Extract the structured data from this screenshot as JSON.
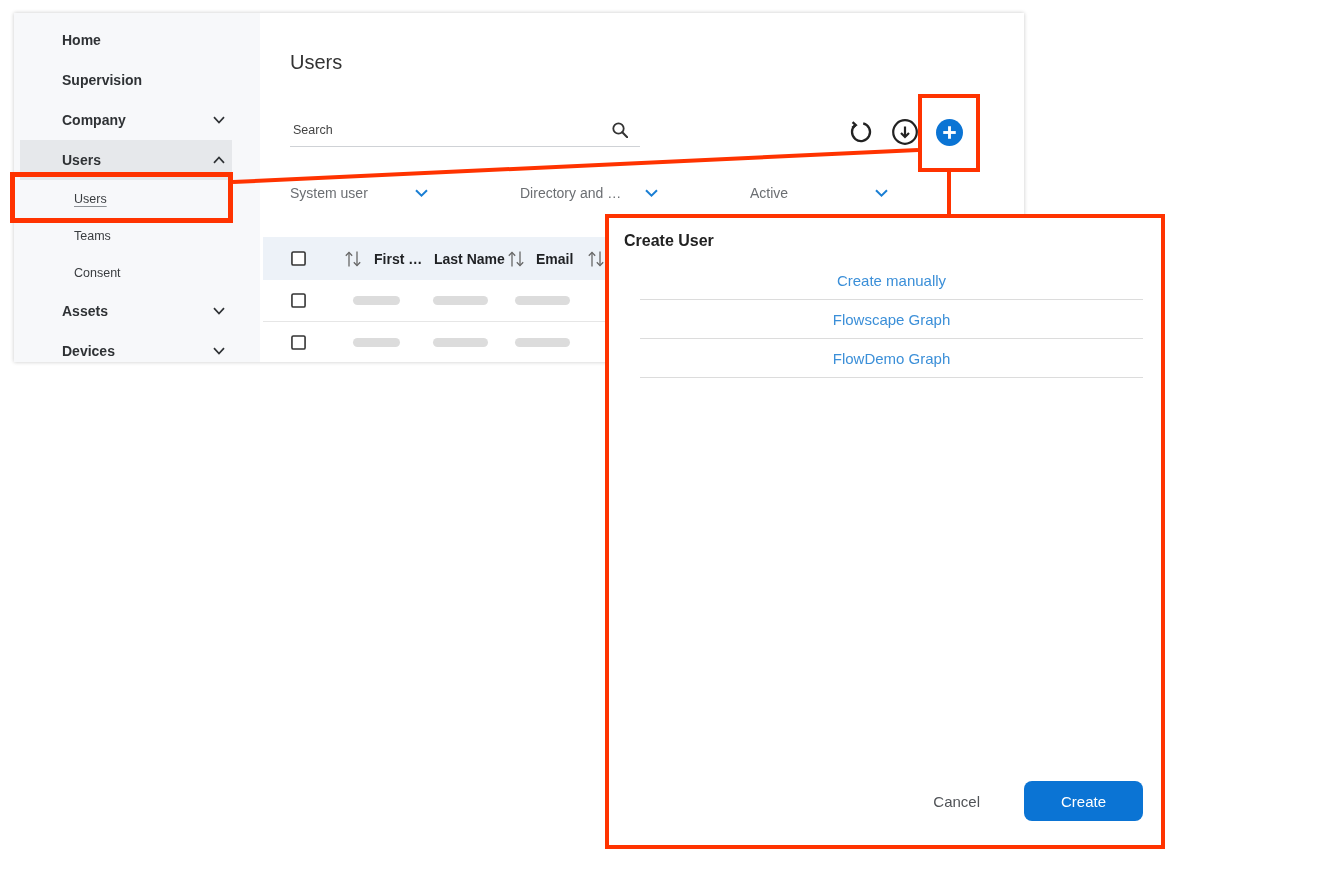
{
  "sidebar": {
    "items": [
      {
        "label": "Home",
        "kind": "link",
        "selected": false
      },
      {
        "label": "Supervision",
        "kind": "link",
        "selected": false
      },
      {
        "label": "Company",
        "kind": "group",
        "expanded": false,
        "selected": false
      },
      {
        "label": "Users",
        "kind": "group",
        "expanded": true,
        "selected": true,
        "children": [
          {
            "label": "Users",
            "selected": true,
            "highlighted": true
          },
          {
            "label": "Teams",
            "selected": false,
            "highlighted": false
          },
          {
            "label": "Consent",
            "selected": false,
            "highlighted": false
          }
        ]
      },
      {
        "label": "Assets",
        "kind": "group",
        "expanded": false,
        "selected": false
      },
      {
        "label": "Devices",
        "kind": "group",
        "expanded": false,
        "selected": false
      }
    ]
  },
  "main": {
    "title": "Users",
    "search": {
      "placeholder": "Search"
    },
    "toolbar": [
      {
        "kind": "refresh",
        "highlighted": false
      },
      {
        "kind": "download",
        "highlighted": false
      },
      {
        "kind": "add",
        "highlighted": true
      }
    ],
    "filters": [
      {
        "value": "System user"
      },
      {
        "value": "Directory and …"
      },
      {
        "value": "Active"
      }
    ],
    "table": {
      "all_selected": false,
      "columns": [
        {
          "label": "First …",
          "kind": "leading"
        },
        {
          "label": "Last Name",
          "kind": "trailing"
        },
        {
          "label": "Email",
          "kind": "trailing"
        }
      ],
      "rows": [
        {
          "selected": false,
          "cells": [
            {
              "redacted": true
            },
            {
              "redacted": true
            },
            {
              "redacted": true
            }
          ]
        },
        {
          "selected": false,
          "cells": [
            {
              "redacted": true
            },
            {
              "redacted": true
            },
            {
              "redacted": true
            }
          ]
        }
      ]
    }
  },
  "dialog": {
    "title": "Create User",
    "highlighted": true,
    "options": [
      {
        "label": "Create manually"
      },
      {
        "label": "Flowscape Graph"
      },
      {
        "label": "FlowDemo Graph"
      }
    ],
    "buttons": [
      {
        "label": "Cancel",
        "kind": "cancel"
      },
      {
        "label": "Create",
        "kind": "submit"
      }
    ]
  }
}
